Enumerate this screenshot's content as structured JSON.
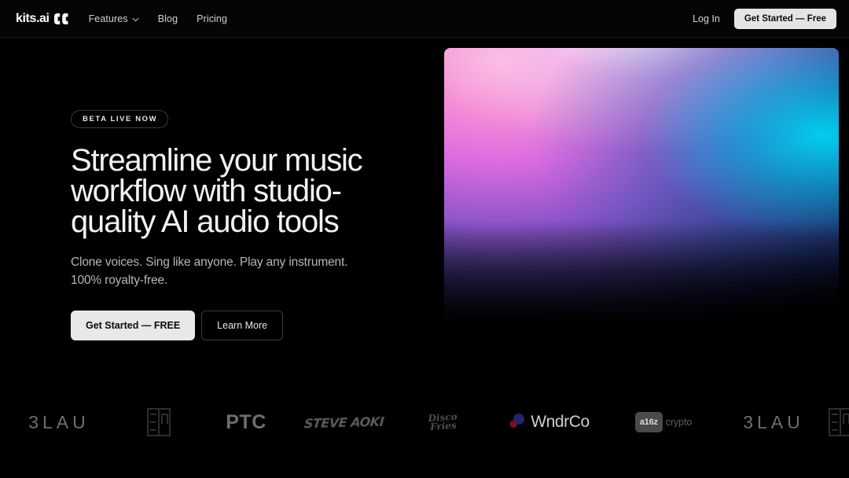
{
  "brand": {
    "name": "kits.ai",
    "logo_mark_icon": "kits-double-chevron-icon"
  },
  "header": {
    "nav": [
      {
        "label": "Features",
        "has_dropdown": true,
        "icon": "chevron-down-icon"
      },
      {
        "label": "Blog",
        "has_dropdown": false
      },
      {
        "label": "Pricing",
        "has_dropdown": false
      }
    ],
    "login_label": "Log In",
    "cta_label": "Get Started — Free",
    "cta_bg": "#e4e4e4",
    "cta_fg": "#0b0b0b"
  },
  "hero": {
    "badge": "BETA LIVE NOW",
    "headline": "Streamline your music workflow with studio-quality AI audio tools",
    "subhead": "Clone voices. Sing like anyone. Play any instrument. 100% royalty-free.",
    "primary_cta": "Get Started — FREE",
    "secondary_cta": "Learn More",
    "gradient": {
      "pink": "#f58fd6",
      "magenta": "#d96ae0",
      "purple": "#8a54c8",
      "indigo": "#3b357f",
      "cyan": "#00d0ee",
      "black": "#000000"
    }
  },
  "marquee": {
    "logos": [
      {
        "name": "3LAU",
        "type": "wordmark"
      },
      {
        "name": "EA",
        "type": "square-mark"
      },
      {
        "name": "PTC",
        "type": "wordmark"
      },
      {
        "name": "STEVE AOKI",
        "type": "graffiti-wordmark"
      },
      {
        "name": "Disco Fries",
        "line1": "Disco",
        "line2": "Fries",
        "type": "script-wordmark"
      },
      {
        "name": "WndrCo",
        "type": "wordmark-with-dots",
        "dot_blue": "#20256e",
        "dot_red": "#7a1020"
      },
      {
        "name": "a16z crypto",
        "badge": "a16z",
        "word": "crypto",
        "type": "badge-wordmark"
      },
      {
        "name": "3LAU",
        "type": "wordmark"
      },
      {
        "name": "EA",
        "type": "square-mark"
      }
    ]
  }
}
